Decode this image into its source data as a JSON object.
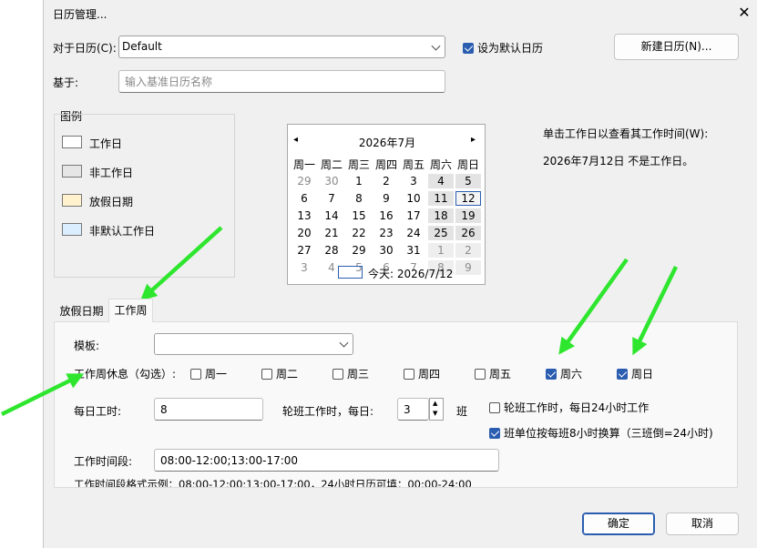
{
  "window": {
    "title": "日历管理...",
    "close_glyph": "✕"
  },
  "calendar_for": {
    "label": "对于日历(C):",
    "value": "Default"
  },
  "set_default": {
    "label": "设为默认日历",
    "checked": true
  },
  "new_calendar_button": "新建日历(N)...",
  "based_on": {
    "label": "基于:",
    "placeholder": "输入基准日历名称"
  },
  "legend": {
    "title": "图例",
    "items": [
      {
        "label": "工作日",
        "color": "#ffffff"
      },
      {
        "label": "非工作日",
        "color": "#e6e6e6"
      },
      {
        "label": "放假日期",
        "color": "#fff2cc"
      },
      {
        "label": "非默认工作日",
        "color": "#dbeeff"
      }
    ]
  },
  "month_calendar": {
    "prev_glyph": "◂",
    "next_glyph": "▸",
    "month_label": "2026年7月",
    "weekdays": [
      "周一",
      "周二",
      "周三",
      "周四",
      "周五",
      "周六",
      "周日"
    ],
    "rows": [
      [
        "29",
        "30",
        "1",
        "2",
        "3",
        "4",
        "5"
      ],
      [
        "6",
        "7",
        "8",
        "9",
        "10",
        "11",
        "12"
      ],
      [
        "13",
        "14",
        "15",
        "16",
        "17",
        "18",
        "19"
      ],
      [
        "20",
        "21",
        "22",
        "23",
        "24",
        "25",
        "26"
      ],
      [
        "27",
        "28",
        "29",
        "30",
        "31",
        "1",
        "2"
      ],
      [
        "3",
        "4",
        "5",
        "6",
        "7",
        "8",
        "9"
      ]
    ],
    "today_label": "今天: 2026/7/12"
  },
  "info": {
    "prompt": "单击工作日以查看其工作时间(W):",
    "result": "2026年7月12日 不是工作日。"
  },
  "tabs": [
    {
      "label": "放假日期",
      "active": false
    },
    {
      "label": "工作周",
      "active": true
    }
  ],
  "template": {
    "label": "模板:",
    "value": ""
  },
  "weekly_rest": {
    "label": "工作周休息（勾选）:",
    "days": [
      {
        "label": "周一",
        "checked": false
      },
      {
        "label": "周二",
        "checked": false
      },
      {
        "label": "周三",
        "checked": false
      },
      {
        "label": "周四",
        "checked": false
      },
      {
        "label": "周五",
        "checked": false
      },
      {
        "label": "周六",
        "checked": true
      },
      {
        "label": "周日",
        "checked": true
      }
    ]
  },
  "daily_hours": {
    "label": "每日工时:",
    "value": "8"
  },
  "shift": {
    "label": "轮班工作时，每日:",
    "value": "3",
    "unit": "班",
    "up_glyph": "▲",
    "down_glyph": "▼"
  },
  "shift_24h": {
    "label": "轮班工作时，每日24小时工作",
    "checked": false
  },
  "shift_convert": {
    "label": "班单位按每班8小时换算（三班倒=24小时)",
    "checked": true
  },
  "work_periods": {
    "label": "工作时间段:",
    "value": "08:00-12:00;13:00-17:00"
  },
  "format_example": "工作时间段格式示例：08:00-12:00;13:00-17:00，24小时日历可填：00:00-24:00",
  "ok_button": "确定",
  "cancel_button": "取消",
  "annotation_color": "#2ee62e"
}
